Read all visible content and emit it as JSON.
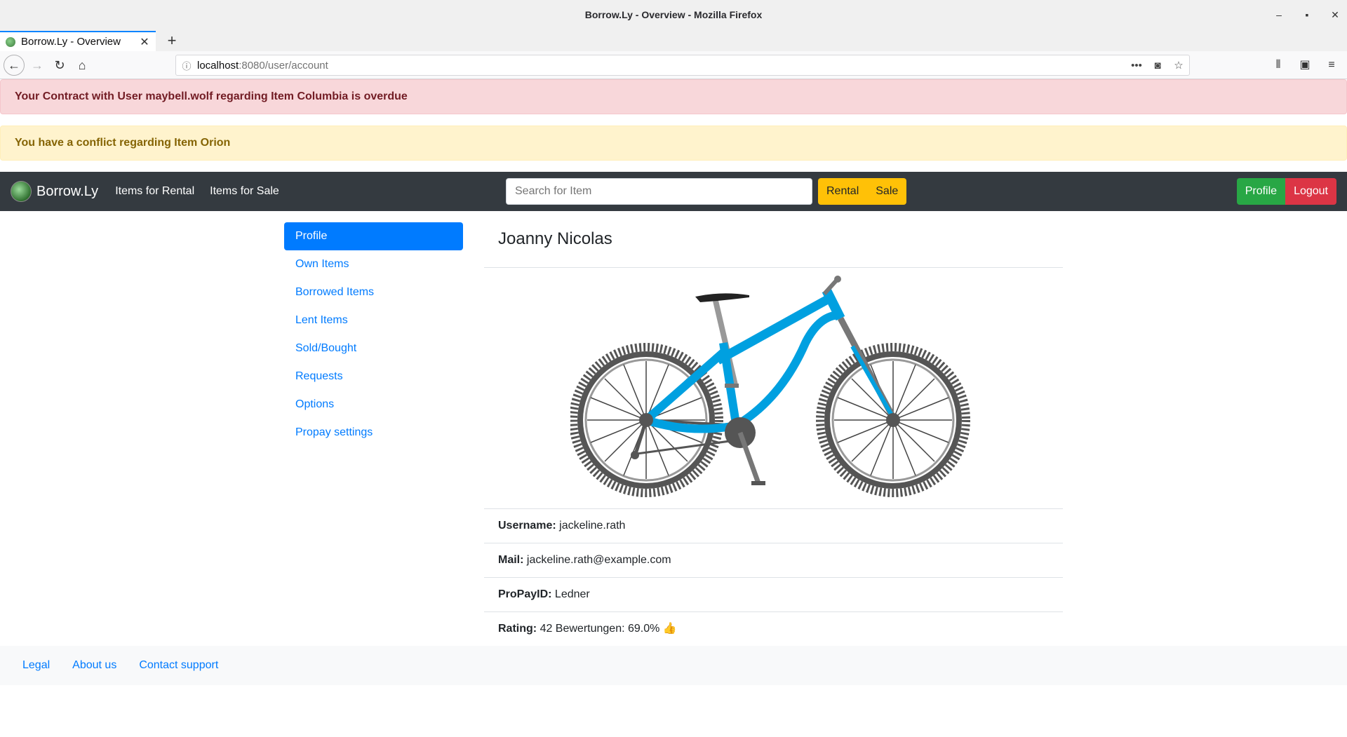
{
  "window": {
    "title": "Borrow.Ly - Overview - Mozilla Firefox",
    "controls": [
      "–",
      "▪",
      "✕"
    ]
  },
  "browser": {
    "tab_title": "Borrow.Ly - Overview",
    "tab_close": "✕",
    "new_tab": "+",
    "url_host": "localhost",
    "url_rest": ":8080/user/account"
  },
  "alerts": {
    "overdue": "Your Contract with User maybell.wolf regarding Item Columbia is overdue",
    "conflict": "You have a conflict regarding Item Orion"
  },
  "navbar": {
    "brand": "Borrow.Ly",
    "link_rental": "Items for Rental",
    "link_sale": "Items for Sale",
    "search_placeholder": "Search for Item",
    "btn_rental": "Rental",
    "btn_sale": "Sale",
    "btn_profile": "Profile",
    "btn_logout": "Logout"
  },
  "sidebar": {
    "items": [
      {
        "label": "Profile",
        "active": true
      },
      {
        "label": "Own Items"
      },
      {
        "label": "Borrowed Items"
      },
      {
        "label": "Lent Items"
      },
      {
        "label": "Sold/Bought"
      },
      {
        "label": "Requests"
      },
      {
        "label": "Options"
      },
      {
        "label": "Propay settings"
      }
    ]
  },
  "profile": {
    "name": "Joanny Nicolas",
    "username_label": "Username:",
    "username": "jackeline.rath",
    "mail_label": "Mail:",
    "mail": "jackeline.rath@example.com",
    "propay_label": "ProPayID:",
    "propay": "Ledner",
    "rating_label": "Rating:",
    "rating": "42 Bewertungen: 69.0%",
    "rating_icon": "thumbs-up-icon"
  },
  "footer": {
    "legal": "Legal",
    "about": "About us",
    "support": "Contact support"
  },
  "colors": {
    "primary": "#007bff",
    "dark_nav": "#343a40",
    "warning": "#ffc107",
    "success": "#28a745",
    "danger": "#dc3545",
    "bike_frame": "#00a0e0"
  }
}
